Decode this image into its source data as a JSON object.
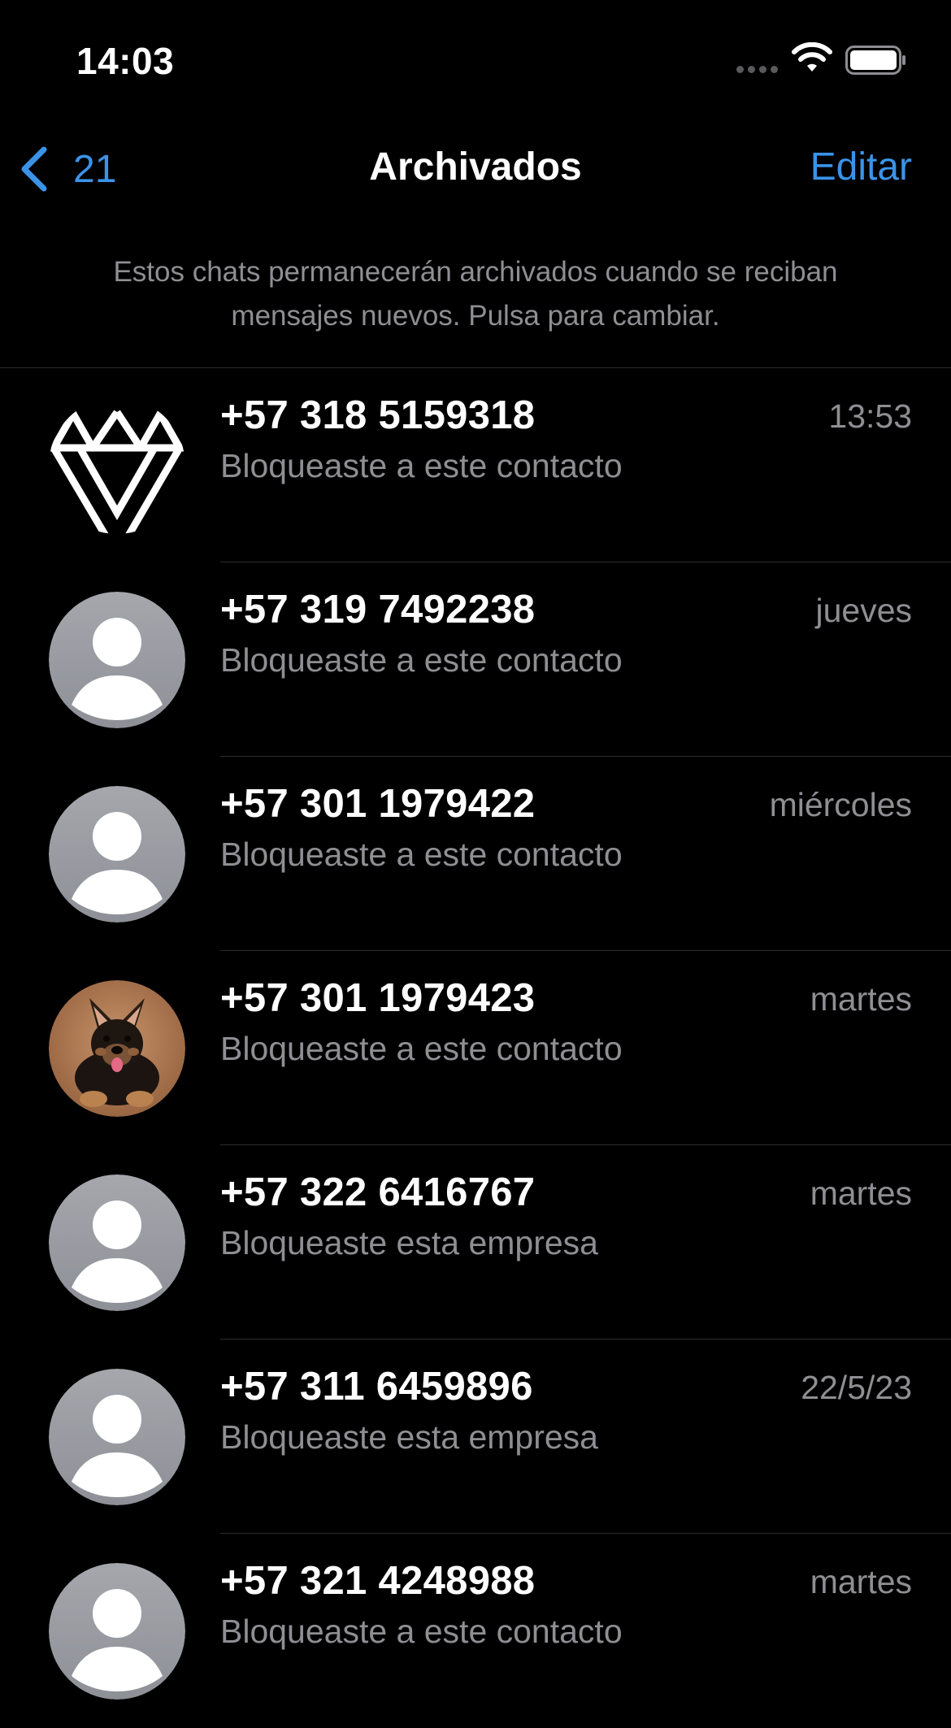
{
  "status_bar": {
    "time": "14:03",
    "icons": [
      "signal-dots-icon",
      "wifi-icon",
      "battery-icon"
    ]
  },
  "nav": {
    "back_count": "21",
    "title": "Archivados",
    "edit_label": "Editar"
  },
  "notice": "Estos chats permanecerán archivados cuando se reciban mensajes nuevos. Pulsa para cambiar.",
  "chats": [
    {
      "name": "+57 318 5159318",
      "preview": "Bloqueaste a este contacto",
      "date": "13:53",
      "avatar": "geometric-logo-icon"
    },
    {
      "name": "+57 319 7492238",
      "preview": "Bloqueaste a este contacto",
      "date": "jueves",
      "avatar": "default-person-icon"
    },
    {
      "name": "+57 301 1979422",
      "preview": "Bloqueaste a este contacto",
      "date": "miércoles",
      "avatar": "default-person-icon"
    },
    {
      "name": "+57 301 1979423",
      "preview": "Bloqueaste a este contacto",
      "date": "martes",
      "avatar": "puppy-photo"
    },
    {
      "name": "+57 322 6416767",
      "preview": "Bloqueaste esta empresa",
      "date": "martes",
      "avatar": "default-person-icon"
    },
    {
      "name": "+57 311 6459896",
      "preview": "Bloqueaste esta empresa",
      "date": "22/5/23",
      "avatar": "default-person-icon"
    },
    {
      "name": "+57 321 4248988",
      "preview": "Bloqueaste a este contacto",
      "date": "martes",
      "avatar": "default-person-icon"
    }
  ],
  "colors": {
    "background": "#000000",
    "accent": "#3b93e8",
    "secondary_text": "#8e8e93",
    "divider": "#2c2c2e",
    "avatar_gray": "#9a9ca3"
  }
}
